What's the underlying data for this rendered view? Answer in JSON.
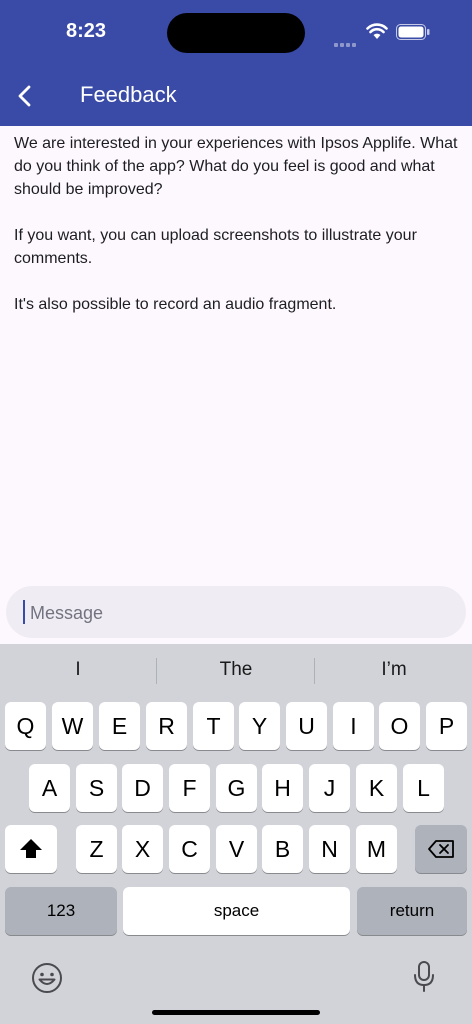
{
  "status": {
    "time": "8:23"
  },
  "header": {
    "title": "Feedback"
  },
  "body": {
    "para1": "We are interested in your experiences with Ipsos Applife. What do you think of the app? What do you feel is good and what should be improved?",
    "para2": "If you want, you can upload screenshots to illustrate your comments.",
    "para3": "It's also possible to record an audio fragment."
  },
  "message": {
    "placeholder": "Message",
    "value": ""
  },
  "keyboard": {
    "suggestions": [
      "I",
      "The",
      "I’m"
    ],
    "row1": [
      "Q",
      "W",
      "E",
      "R",
      "T",
      "Y",
      "U",
      "I",
      "O",
      "P"
    ],
    "row2": [
      "A",
      "S",
      "D",
      "F",
      "G",
      "H",
      "J",
      "K",
      "L"
    ],
    "row3": [
      "Z",
      "X",
      "C",
      "V",
      "B",
      "N",
      "M"
    ],
    "numbers_label": "123",
    "space_label": "space",
    "return_label": "return"
  },
  "colors": {
    "header": "#3a4ba7",
    "background": "#fdf8fd",
    "keyboard": "#d1d3d9"
  }
}
